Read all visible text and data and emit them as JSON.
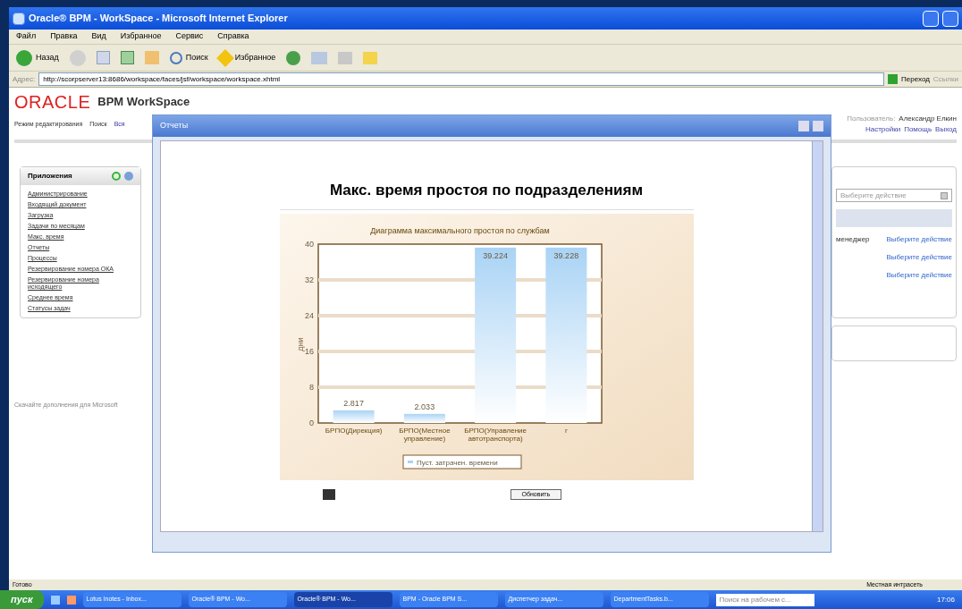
{
  "window": {
    "title": "Oracle® BPM - WorkSpace - Microsoft Internet Explorer"
  },
  "menu": [
    "Файл",
    "Правка",
    "Вид",
    "Избранное",
    "Сервис",
    "Справка"
  ],
  "toolbar": {
    "back": "Назад",
    "search": "Поиск",
    "favorites": "Избранное"
  },
  "address": {
    "label": "Адрес:",
    "url": "http://scorpserver13:8686/workspace/faces/jsf/workspace/workspace.xhtml",
    "go": "Переход",
    "links": "Ссылки"
  },
  "page": {
    "logo": "ORACLE",
    "product": "BPM WorkSpace",
    "nav": [
      "Режим редактирования",
      "Поиск",
      "Вся"
    ],
    "user_label": "Пользователь:",
    "user": "Александр Елкин",
    "user_links": [
      "Настройки",
      "Помощь",
      "Выход"
    ],
    "apps_panel": {
      "title": "Приложения",
      "items": [
        "Администрирование",
        "Входящий документ",
        "Загрузка",
        "Задачи по месяцам",
        "Макс. время",
        "Отчеты",
        "Процессы",
        "Резервирование номера ОКА",
        "Резервирование номера исходящего",
        "Среднее время",
        "Статусы задач"
      ]
    },
    "download_note": "Скачайте дополнения для Microsoft",
    "actions": {
      "select_placeholder": "Выберите действие",
      "row_text": "менеджер",
      "links": [
        "Выберите действие",
        "Выберите действие",
        "Выберите действие"
      ]
    }
  },
  "dialog": {
    "title": "Отчеты",
    "heading": "Макс. время простоя по подразделениям",
    "refresh": "Обновить",
    "chart_data": {
      "type": "bar",
      "title": "Диаграмма максимального простоя по службам",
      "ylabel": "дни",
      "categories": [
        "БРПО(Дирекция)",
        "БРПО(Местное управление)",
        "БРПО(Управление автотранспорта)",
        "г"
      ],
      "series": [
        {
          "name": "Пуст. затрачен. времени",
          "color": "#a9d3f5",
          "values": [
            2.817,
            2.033,
            39.224,
            39.228
          ]
        }
      ],
      "ylim": [
        0,
        40
      ],
      "yticks": [
        0,
        8,
        16,
        24,
        32,
        40
      ],
      "grid": true,
      "data_labels": true
    }
  },
  "status_bar": {
    "text": "Готово",
    "zone": "Местная интрасеть"
  },
  "taskbar": {
    "start": "пуск",
    "tasks": [
      {
        "label": "Lotus Inotes - Inbox...",
        "selected": false
      },
      {
        "label": "Oracle® BPM - Wo...",
        "selected": false
      },
      {
        "label": "Oracle® BPM - Wo...",
        "selected": true
      },
      {
        "label": "BPM - Oracle BPM S...",
        "selected": false
      },
      {
        "label": "Диспетчер задач...",
        "selected": false
      },
      {
        "label": "DepartmentTasks.b...",
        "selected": false
      }
    ],
    "search_placeholder": "Поиск на рабочем с...",
    "time": "17:06"
  }
}
